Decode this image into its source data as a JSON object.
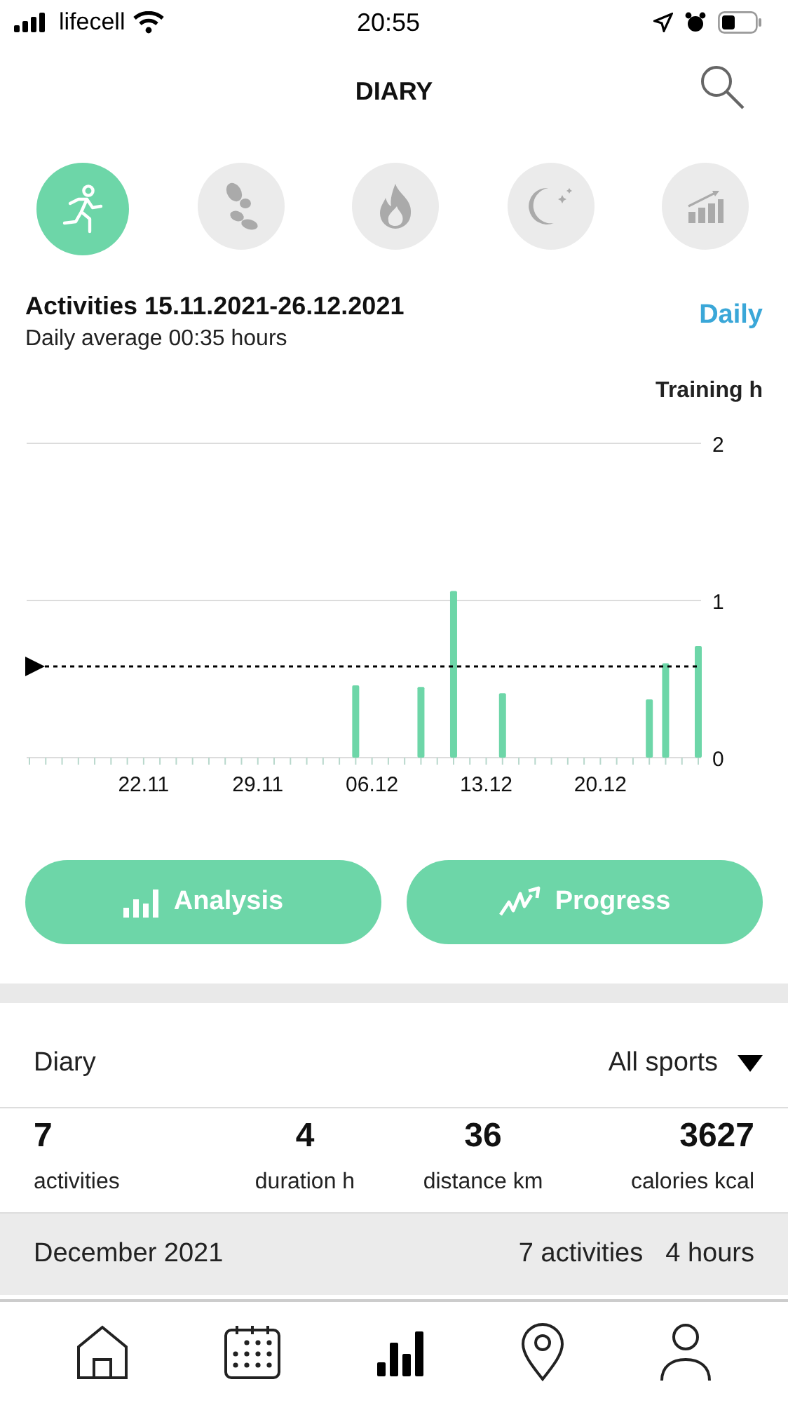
{
  "status_bar": {
    "carrier": "lifecell",
    "time": "20:55"
  },
  "header": {
    "title": "DIARY"
  },
  "category_tabs": [
    {
      "kind": "activity",
      "selected": true
    },
    {
      "kind": "steps",
      "selected": false
    },
    {
      "kind": "calories",
      "selected": false
    },
    {
      "kind": "sleep",
      "selected": false
    },
    {
      "kind": "progress",
      "selected": false
    }
  ],
  "summary": {
    "title": "Activities 15.11.2021-26.12.2021",
    "subtitle": "Daily average 00:35 hours",
    "period": "Daily"
  },
  "chart_data": {
    "type": "bar",
    "ylabel": "Training h",
    "ylim": [
      0,
      2
    ],
    "yticks": [
      0,
      1,
      2
    ],
    "categories": [
      null,
      null,
      null,
      null,
      null,
      null,
      null,
      "22.11",
      null,
      null,
      null,
      null,
      null,
      null,
      "29.11",
      null,
      null,
      null,
      null,
      null,
      null,
      "06.12",
      null,
      null,
      null,
      null,
      null,
      null,
      "13.12",
      null,
      null,
      null,
      null,
      null,
      null,
      "20.12",
      null,
      null,
      null,
      null,
      null,
      null
    ],
    "series": [
      {
        "color": "#6dd6a8",
        "values": [
          0,
          0,
          0,
          0,
          0,
          0,
          0,
          0,
          0,
          0,
          0,
          0,
          0,
          0,
          0,
          0,
          0,
          0,
          0,
          0,
          0.46,
          0,
          0,
          0,
          0.45,
          0,
          1.06,
          0,
          0,
          0.41,
          0,
          0,
          0,
          0,
          0,
          0,
          0,
          0,
          0.37,
          0.6,
          0,
          0.71
        ]
      }
    ],
    "ref_lines": [
      {
        "axis": "y",
        "value": 0.58
      }
    ]
  },
  "actions": [
    {
      "kind": "analysis",
      "label": "Analysis"
    },
    {
      "kind": "progress",
      "label": "Progress"
    }
  ],
  "diary": {
    "title": "Diary",
    "filter": "All sports"
  },
  "stats": [
    {
      "value": "7",
      "label": "activities"
    },
    {
      "value": "4",
      "label": "duration h"
    },
    {
      "value": "36",
      "label": "distance km"
    },
    {
      "value": "3627",
      "label": "calories kcal"
    }
  ],
  "month": {
    "title": "December 2021",
    "activities": "7 activities",
    "hours": "4 hours"
  },
  "tab_bar": [
    {
      "kind": "home",
      "selected": false
    },
    {
      "kind": "calendar",
      "selected": false
    },
    {
      "kind": "diary",
      "selected": true
    },
    {
      "kind": "map",
      "selected": false
    },
    {
      "kind": "profile",
      "selected": false
    }
  ]
}
